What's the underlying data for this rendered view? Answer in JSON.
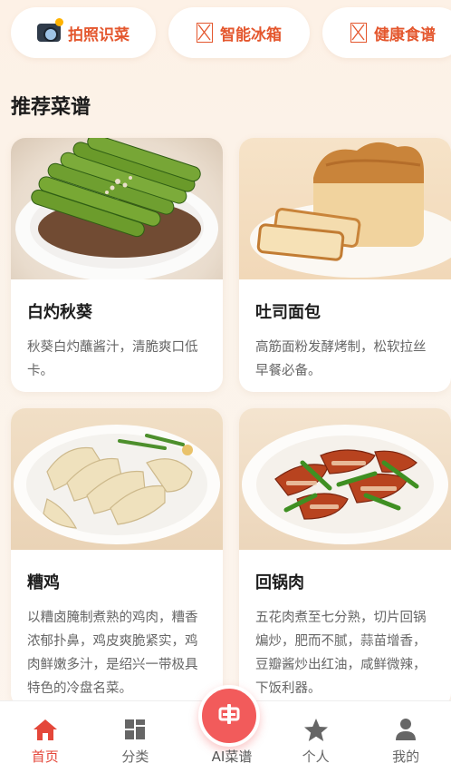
{
  "quick_actions": [
    {
      "label": "拍照识菜",
      "icon": "camera-icon"
    },
    {
      "label": "智能冰箱",
      "icon": "missing-image-icon"
    },
    {
      "label": "健康食谱",
      "icon": "missing-image-icon"
    }
  ],
  "section": {
    "title": "推荐菜谱"
  },
  "recipes": [
    {
      "title": "白灼秋葵",
      "desc": "秋葵白灼蘸酱汁，清脆爽口低卡。",
      "image": "okra-photo"
    },
    {
      "title": "吐司面包",
      "desc": "高筋面粉发酵烤制，松软拉丝早餐必备。",
      "image": "bread-photo"
    },
    {
      "title": "糟鸡",
      "desc": "以糟卤腌制煮熟的鸡肉，糟香浓郁扑鼻，鸡皮爽脆紧实，鸡肉鲜嫩多汁，是绍兴一带极具特色的冷盘名菜。",
      "image": "chicken-photo"
    },
    {
      "title": "回锅肉",
      "desc": "五花肉煮至七分熟，切片回锅煸炒，肥而不腻，蒜苗增香，豆瓣酱炒出红油，咸鲜微辣，下饭利器。",
      "image": "pork-photo"
    }
  ],
  "nav": {
    "home": "首页",
    "category": "分类",
    "ai": "AI菜谱",
    "personal": "个人",
    "mine": "我的"
  },
  "colors": {
    "accent": "#e4473a",
    "quick_text": "#e4572e",
    "ai_button": "#f25b5b"
  }
}
